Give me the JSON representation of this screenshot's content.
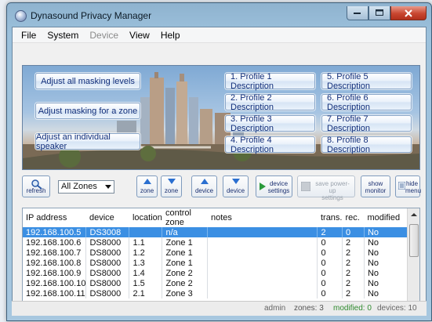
{
  "window": {
    "title": "Dynasound Privacy Manager"
  },
  "menu": [
    {
      "label": "File",
      "enabled": true
    },
    {
      "label": "System",
      "enabled": true
    },
    {
      "label": "Device",
      "enabled": false
    },
    {
      "label": "View",
      "enabled": true
    },
    {
      "label": "Help",
      "enabled": true
    }
  ],
  "banner": {
    "adjust_all": "Adjust all masking levels",
    "adjust_zone": "Adjust masking for a zone",
    "adjust_speaker": "Adjust an individual speaker",
    "profiles": [
      "1. Profile 1 Description",
      "2. Profile 2 Description",
      "3. Profile 3 Description",
      "4. Profile 4 Description",
      "5. Profile 5 Description",
      "6. Profile 6 Description",
      "7. Profile 7 Description",
      "8. Profile 8 Description"
    ]
  },
  "toolbar": {
    "refresh": "refresh",
    "zone_select": "All Zones",
    "zone_up": "zone",
    "zone_down": "zone",
    "device_up": "device",
    "device_down": "device",
    "device_settings_1": "device",
    "device_settings_2": "settings",
    "save_powerup_1": "save power-up",
    "save_powerup_2": "settings",
    "show_monitor_1": "show",
    "show_monitor_2": "monitor",
    "hide_menu_1": "hide",
    "hide_menu_2": "menu"
  },
  "table": {
    "columns": [
      "IP address",
      "device",
      "location",
      "control zone",
      "notes",
      "trans.",
      "rec.",
      "modified"
    ],
    "rows": [
      [
        "192.168.100.5",
        "DS3008",
        "",
        "n/a",
        "",
        "2",
        "0",
        "No"
      ],
      [
        "192.168.100.6",
        "DS8000",
        "1.1",
        "Zone 1",
        "",
        "0",
        "2",
        "No"
      ],
      [
        "192.168.100.7",
        "DS8000",
        "1.2",
        "Zone 1",
        "",
        "0",
        "2",
        "No"
      ],
      [
        "192.168.100.8",
        "DS8000",
        "1.3",
        "Zone 1",
        "",
        "0",
        "2",
        "No"
      ],
      [
        "192.168.100.9",
        "DS8000",
        "1.4",
        "Zone 2",
        "",
        "0",
        "2",
        "No"
      ],
      [
        "192.168.100.10",
        "DS8000",
        "1.5",
        "Zone 2",
        "",
        "0",
        "2",
        "No"
      ],
      [
        "192.168.100.11",
        "DS8000",
        "2.1",
        "Zone 3",
        "",
        "0",
        "2",
        "No"
      ]
    ],
    "selected_row": 0
  },
  "status": {
    "user": "admin",
    "zones": "zones: 3",
    "modified": "modified: 0",
    "devices": "devices: 10"
  },
  "colors": {
    "selection": "#3b8fe3",
    "status_modified": "#2f8a2f",
    "button_text": "#112e7a"
  }
}
